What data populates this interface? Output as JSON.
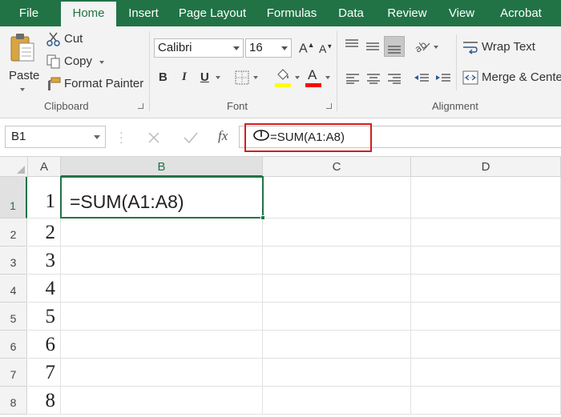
{
  "tabs": {
    "file": "File",
    "home": "Home",
    "insert": "Insert",
    "page_layout": "Page Layout",
    "formulas": "Formulas",
    "data": "Data",
    "review": "Review",
    "view": "View",
    "acrobat": "Acrobat"
  },
  "clipboard": {
    "paste": "Paste",
    "cut": "Cut",
    "copy": "Copy",
    "format_painter": "Format Painter",
    "group_label": "Clipboard"
  },
  "font": {
    "name": "Calibri",
    "size": "16",
    "bold": "B",
    "italic": "I",
    "underline": "U",
    "group_label": "Font",
    "highlight_color": "#ffff00",
    "font_color": "#ff0000"
  },
  "alignment": {
    "wrap_text": "Wrap Text",
    "merge_center": "Merge & Center",
    "group_label": "Alignment"
  },
  "formula_bar": {
    "name_box": "B1",
    "fx": "fx",
    "formula": "=SUM(A1:A8)"
  },
  "sheet": {
    "columns": [
      "A",
      "B",
      "C",
      "D"
    ],
    "rows": [
      "1",
      "2",
      "3",
      "4",
      "5",
      "6",
      "7",
      "8"
    ],
    "col_a_values": [
      "1",
      "2",
      "3",
      "4",
      "5",
      "6",
      "7",
      "8"
    ],
    "active_cell_text": "=SUM(A1:A8)"
  },
  "colors": {
    "accent": "#217346",
    "highlight_box": "#d01e1e"
  }
}
